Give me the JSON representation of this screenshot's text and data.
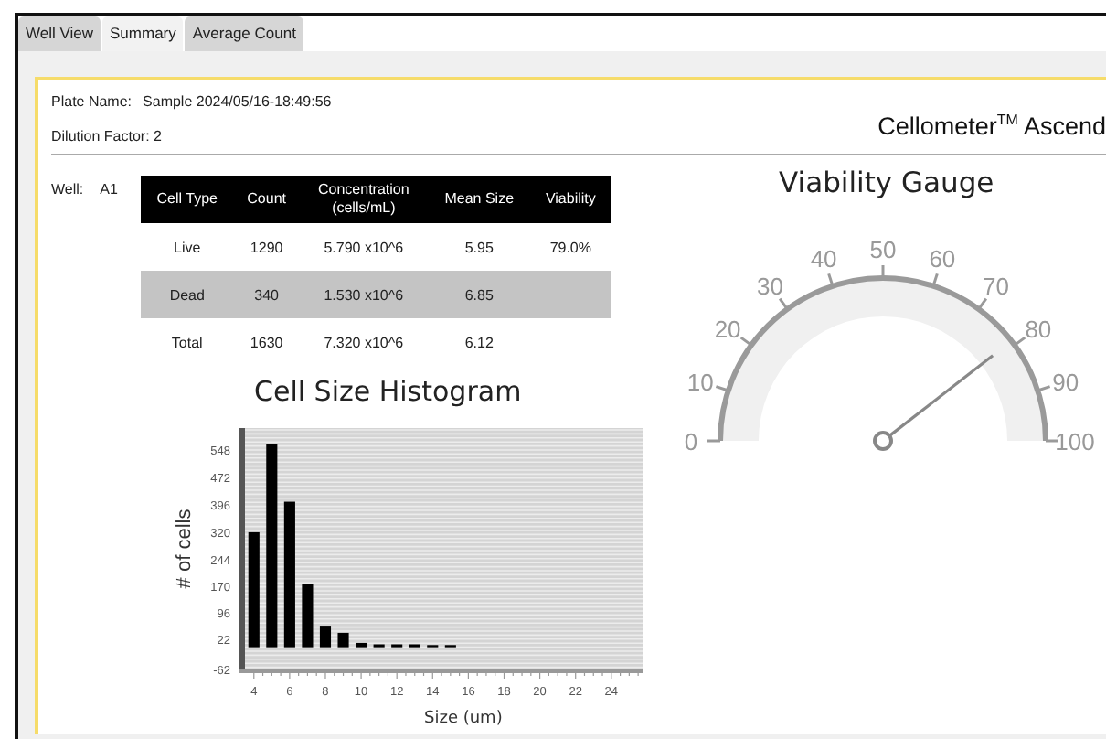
{
  "tabs": [
    {
      "label": "Well View",
      "selected": false
    },
    {
      "label": "Summary",
      "selected": true
    },
    {
      "label": "Average Count",
      "selected": false
    }
  ],
  "header": {
    "plate_name_label": "Plate Name:",
    "plate_name": "Sample 2024/05/16-18:49:56",
    "dilution_factor": "Dilution Factor: 2",
    "product": "Cellometer$^{TM}$ Ascend"
  },
  "well": {
    "label": "Well:",
    "value": "A1"
  },
  "table": {
    "columns": [
      "Cell Type",
      "Count",
      "Concentration (cells/mL)",
      "Mean Size",
      "Viability"
    ],
    "rows": [
      {
        "cells": [
          "Live",
          "1290",
          "5.790 x10^6",
          "5.95",
          "79.0%"
        ],
        "shaded": false
      },
      {
        "cells": [
          "Dead",
          "340",
          "1.530 x10^6",
          "6.85",
          ""
        ],
        "shaded": true
      },
      {
        "cells": [
          "Total",
          "1630",
          "7.320 x10^6",
          "6.12",
          ""
        ],
        "shaded": false
      }
    ]
  },
  "histogram": {
    "chart_data": {
      "type": "bar",
      "title": "Cell Size Histogram",
      "xlabel": "Size (um)",
      "ylabel": "# of cells",
      "x": [
        4,
        5,
        6,
        7,
        8,
        9,
        10,
        11,
        12,
        13,
        14,
        15
      ],
      "series": [
        {
          "color": "#000000",
          "values": [
            320,
            565,
            405,
            175,
            60,
            40,
            12,
            8,
            8,
            8,
            6,
            6
          ]
        }
      ],
      "grid": true,
      "xlim": [
        3.5,
        25.8
      ],
      "ylim": [
        -62,
        610
      ],
      "xticks": [
        4,
        6,
        8,
        10,
        12,
        14,
        16,
        18,
        20,
        22,
        24
      ],
      "yticks": [
        -62,
        22,
        96,
        170,
        244,
        320,
        396,
        472,
        548
      ]
    }
  },
  "gauge": {
    "title": "Viability Gauge",
    "level": 0.79,
    "ticks": [
      "0",
      "10",
      "20",
      "30",
      "40",
      "50",
      "60",
      "70",
      "80",
      "90",
      "100"
    ]
  }
}
